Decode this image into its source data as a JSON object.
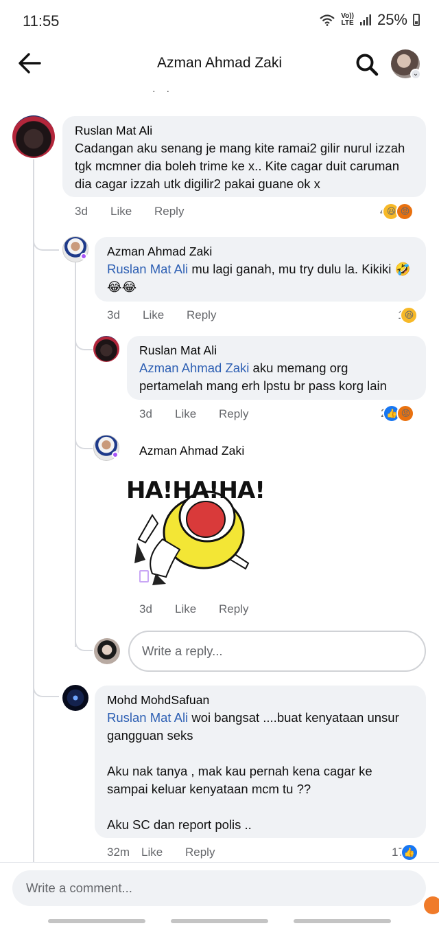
{
  "status_bar": {
    "time": "11:55",
    "net_top": "Vo))",
    "net_bottom": "LTE",
    "battery": "25%"
  },
  "header": {
    "title": "Azman Ahmad Zaki"
  },
  "comments": [
    {
      "author": "Ruslan Mat Ali",
      "text": "Cadangan aku senang je mang kite ramai2 gilir nurul izzah tgk mcmner dia boleh trime ke x.. Kite cagar duit caruman dia cagar izzah utk digilir2 pakai guane ok x",
      "time": "3d",
      "like": "Like",
      "reply": "Reply",
      "reaction_count": "4"
    },
    {
      "author": "Azman Ahmad Zaki",
      "mention": "Ruslan Mat Ali",
      "text": " mu lagi ganah, mu try dulu la. Kikiki 🤣😂😂",
      "time": "3d",
      "like": "Like",
      "reply": "Reply",
      "reaction_count": "1"
    },
    {
      "author": "Ruslan Mat Ali",
      "mention": "Azman Ahmad Zaki",
      "text": " aku memang org pertamelah mang erh lpstu br pass korg lain",
      "time": "3d",
      "like": "Like",
      "reply": "Reply",
      "reaction_count": "2"
    },
    {
      "author": "Azman Ahmad Zaki",
      "sticker_text": "HA!HA!HA!",
      "time": "3d",
      "like": "Like",
      "reply": "Reply"
    },
    {
      "author": "Mohd MohdSafuan",
      "mention": "Ruslan Mat Ali",
      "text": " woi bangsat ....buat kenyataan unsur gangguan seks\n\nAku nak tanya , mak kau pernah kena cagar ke sampai keluar kenyataan mcm tu ??\n\nAku SC dan report polis ..",
      "time": "32m",
      "like": "Like",
      "reply": "Reply",
      "reaction_count": "17"
    }
  ],
  "reply_box": {
    "placeholder": "Write a reply..."
  },
  "comment_box": {
    "placeholder": "Write a comment..."
  },
  "colors": {
    "bubble": "#f0f2f5",
    "mention": "#2d5fb3",
    "like": "#1877f2",
    "haha": "#f7b928",
    "angry": "#e9710f"
  }
}
